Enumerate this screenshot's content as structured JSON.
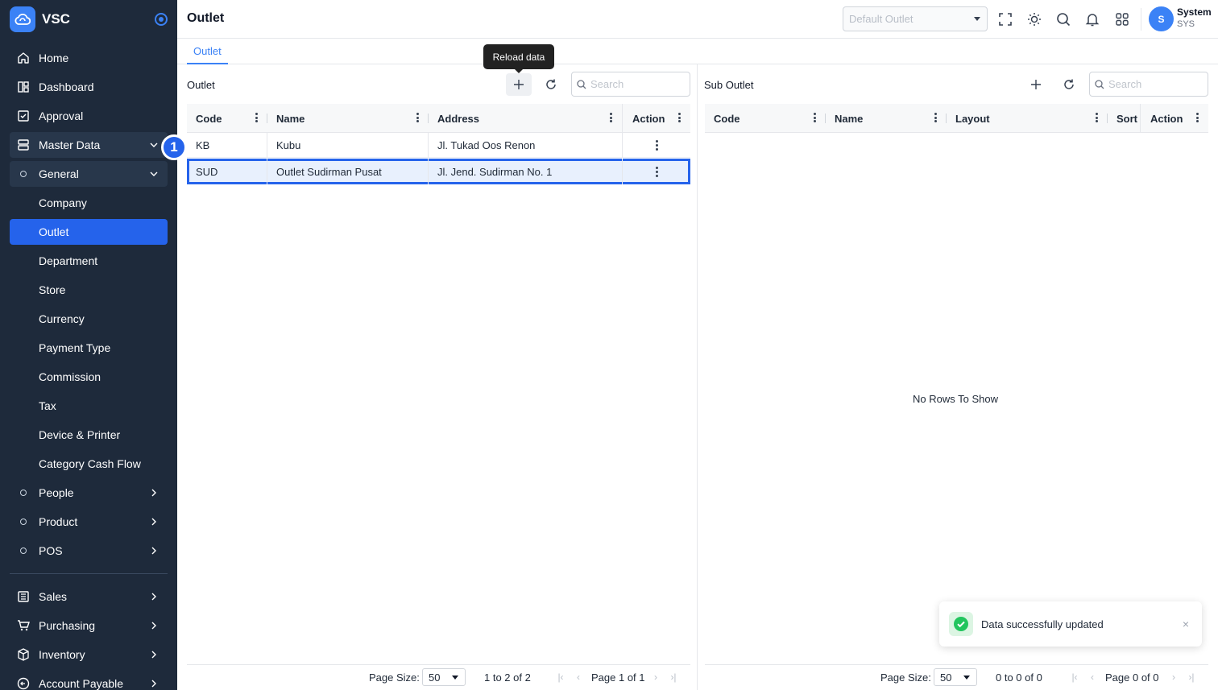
{
  "brand": {
    "name": "VSC"
  },
  "sidebar": {
    "items": [
      {
        "label": "Home"
      },
      {
        "label": "Dashboard"
      },
      {
        "label": "Approval"
      },
      {
        "label": "Master Data"
      },
      {
        "label": "General"
      },
      {
        "label": "Company"
      },
      {
        "label": "Outlet"
      },
      {
        "label": "Department"
      },
      {
        "label": "Store"
      },
      {
        "label": "Currency"
      },
      {
        "label": "Payment Type"
      },
      {
        "label": "Commission"
      },
      {
        "label": "Tax"
      },
      {
        "label": "Device & Printer"
      },
      {
        "label": "Category Cash Flow"
      },
      {
        "label": "People"
      },
      {
        "label": "Product"
      },
      {
        "label": "POS"
      },
      {
        "label": "Sales"
      },
      {
        "label": "Purchasing"
      },
      {
        "label": "Inventory"
      },
      {
        "label": "Account Payable"
      }
    ],
    "step_badge": "1"
  },
  "header": {
    "title": "Outlet",
    "outlet_select_placeholder": "Default Outlet",
    "user_avatar": "S",
    "user_name": "System",
    "user_code": "SYS"
  },
  "tabs": [
    {
      "label": "Outlet"
    }
  ],
  "tooltip": "Reload data",
  "outlet_panel": {
    "title": "Outlet",
    "search_placeholder": "Search",
    "columns": [
      "Code",
      "Name",
      "Address",
      "Action"
    ],
    "rows": [
      {
        "code": "KB",
        "name": "Kubu",
        "address": "Jl. Tukad Oos Renon"
      },
      {
        "code": "SUD",
        "name": "Outlet Sudirman Pusat",
        "address": "Jl. Jend. Sudirman No. 1"
      }
    ],
    "footer": {
      "page_size_label": "Page Size:",
      "page_size": "50",
      "range_text": "1 to 2 of 2",
      "page_text": "Page 1 of 1"
    }
  },
  "sub_outlet_panel": {
    "title": "Sub Outlet",
    "search_placeholder": "Search",
    "columns": [
      "Code",
      "Name",
      "Layout",
      "Sort",
      "Action"
    ],
    "empty_text": "No Rows To Show",
    "footer": {
      "page_size_label": "Page Size:",
      "page_size": "50",
      "range_text": "0 to 0 of 0",
      "page_text": "Page 0 of 0"
    }
  },
  "toast": {
    "message": "Data successfully updated"
  },
  "colors": {
    "sidebar_bg": "#1e2a3b",
    "accent": "#2563eb",
    "success": "#22c55e"
  }
}
